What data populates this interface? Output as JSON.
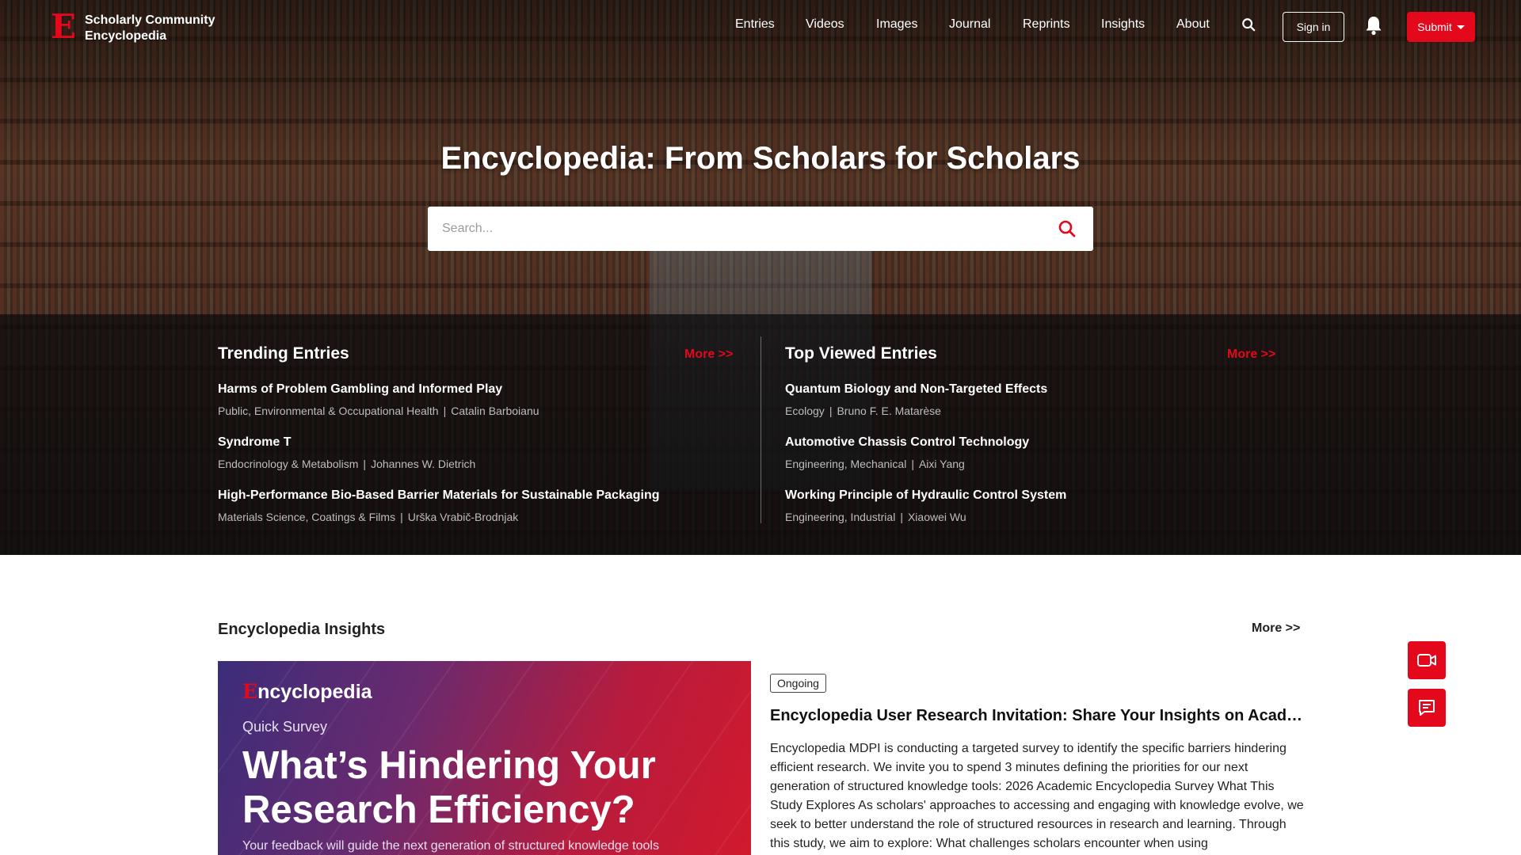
{
  "brand": {
    "name_line1": "Scholarly Community",
    "name_line2": "Encyclopedia",
    "logo_letter": "E"
  },
  "nav": {
    "items": [
      "Entries",
      "Videos",
      "Images",
      "Journal",
      "Reprints",
      "Insights",
      "About"
    ],
    "sign_in": "Sign in",
    "submit": "Submit"
  },
  "hero": {
    "title": "Encyclopedia: From Scholars for Scholars",
    "search_placeholder": "Search..."
  },
  "trending": {
    "title": "Trending Entries",
    "more": "More  >>",
    "entries": [
      {
        "title": "Harms of Problem Gambling and Informed Play",
        "category": "Public, Environmental & Occupational Health",
        "author": "Catalin Barboianu"
      },
      {
        "title": "Syndrome T",
        "category": "Endocrinology & Metabolism",
        "author": "Johannes W. Dietrich"
      },
      {
        "title": "High-Performance Bio-Based Barrier Materials for Sustainable Packaging",
        "category": "Materials Science, Coatings & Films",
        "author": "Urška Vrabič-Brodnjak"
      }
    ]
  },
  "top_viewed": {
    "title": "Top Viewed Entries",
    "more": "More  >>",
    "entries": [
      {
        "title": "Quantum Biology and Non-Targeted Effects",
        "category": "Ecology",
        "author": "Bruno F. E. Matarèse"
      },
      {
        "title": "Automotive Chassis Control Technology",
        "category": "Engineering, Mechanical",
        "author": "Aixi Yang"
      },
      {
        "title": "Working Principle of Hydraulic Control System",
        "category": "Engineering, Industrial",
        "author": "Xiaowei Wu"
      }
    ]
  },
  "insights": {
    "heading": "Encyclopedia Insights",
    "more": "More  >>",
    "banner": {
      "logo_rest": "ncyclopedia",
      "subtitle": "Quick Survey",
      "title": "What’s Hindering Your Research Efficiency?",
      "footer": "Your feedback will guide the next generation of structured knowledge tools"
    },
    "article": {
      "badge": "Ongoing",
      "title": "Encyclopedia User Research Invitation: Share Your Insights on Academic Research",
      "body": "Encyclopedia MDPI is conducting a targeted survey to identify the specific barriers hindering efficient research. We invite you to spend 3 minutes defining the priorities for our next generation of structured knowledge tools: 2026 Academic Encyclopedia Survey What This Study Explores As scholars' approaches to accessing and engaging with knowledge evolve, we seek to better understand the role of structured resources in research and learning. Through this study, we aim to explore: What challenges scholars encounter when using"
    }
  },
  "colors": {
    "accent": "#e3081c",
    "dark_panel": "#0a0a0c",
    "meta_text": "#bdbdbd"
  },
  "icons": {
    "search": "search-icon",
    "bell": "bell-icon",
    "video": "video-icon",
    "chat": "chat-icon"
  }
}
